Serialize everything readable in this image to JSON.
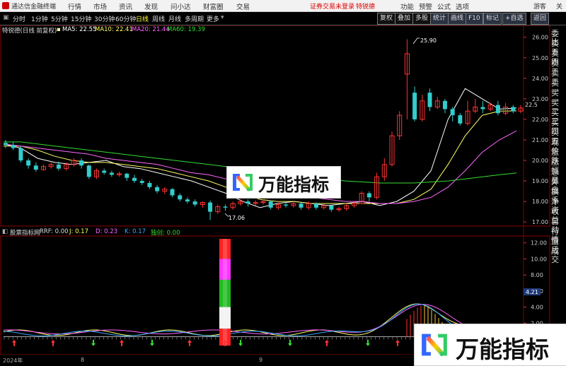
{
  "menubar": {
    "app_title": "通达信金融终端",
    "items": [
      "行情",
      "市场",
      "资讯",
      "发现",
      "问小达",
      "财富圈",
      "交易"
    ],
    "notice": "证券交易未登录",
    "tag": "特锐德",
    "guest": "游客",
    "close": "关"
  },
  "toolbar": {
    "periods": [
      "分时",
      "1分钟",
      "5分钟",
      "15分钟",
      "30分钟",
      "60分钟",
      "日线",
      "周线",
      "月线",
      "多周期",
      "更多"
    ],
    "active_period": "日线",
    "right_buttons": [
      "复权",
      "叠加",
      "多股",
      "统计",
      "画线",
      "F10",
      "标记",
      "+自选",
      "返回"
    ],
    "top_right_links": [
      "功能",
      "预警",
      "公式",
      "选项"
    ]
  },
  "info": {
    "stock": "特锐德(日线 前复权)",
    "ma5_label": "MA5: 22.55",
    "ma10_label": "MA10: 22.41",
    "ma20_label": "MA20: 21.44",
    "ma60_label": "MA60: 19.39"
  },
  "indicator": {
    "name": "股票指标网",
    "rrf": "RRF: 0.00",
    "j": "J: 0.17",
    "d": "D: 0.23",
    "k": "K: 0.17",
    "sig": "独创: 0.00"
  },
  "price_axis": {
    "ticks": [
      "26.00",
      "25.00",
      "24.00",
      "23.00",
      "22.00",
      "21.00",
      "20.00",
      "19.00",
      "18.00",
      "17.00"
    ],
    "current": "22.5"
  },
  "indicator_axis": {
    "ticks": [
      "12.00",
      "10.00",
      "8.00",
      "6.00",
      "4.00",
      "2.00"
    ],
    "current": "4.21"
  },
  "annotations": {
    "high": "25.90",
    "low": "17.06"
  },
  "side_panel": [
    "委比",
    "卖五",
    "卖四",
    "卖三",
    "卖二",
    "卖一",
    "买一",
    "买二",
    "买三",
    "买四",
    "买五",
    "现价",
    "涨跌",
    "涨幅",
    "总量",
    "外盘",
    "换手",
    "净资",
    "收益",
    "自动",
    "行情",
    "盘后",
    "成交"
  ],
  "time_axis": [
    "2024年",
    "8",
    "9"
  ],
  "watermark": "万能指标",
  "colors": {
    "up": "#ff3333",
    "down": "#33cccc",
    "ma5": "#ffffff",
    "ma10": "#ffff66",
    "ma20": "#ff66ff",
    "ma60": "#33dd33",
    "grid": "#8b0000"
  },
  "chart_data": {
    "type": "line",
    "series": [
      {
        "name": "MA5",
        "values": [
          20.8,
          20.6,
          20.1,
          19.9,
          19.8,
          19.9,
          20.0,
          19.7,
          19.6,
          19.4,
          19.2,
          19.0,
          18.7,
          18.4,
          18.0,
          17.7,
          17.9,
          18.0,
          17.9,
          17.8,
          17.9,
          18.0,
          17.8,
          18.0,
          18.5,
          19.5,
          22.0,
          23.5,
          23.0,
          22.5,
          22.55
        ]
      },
      {
        "name": "MA10",
        "values": [
          20.7,
          20.7,
          20.5,
          20.2,
          20.0,
          19.9,
          19.9,
          19.8,
          19.7,
          19.6,
          19.4,
          19.2,
          19.0,
          18.7,
          18.4,
          18.1,
          18.0,
          18.0,
          17.9,
          17.9,
          17.9,
          17.9,
          17.9,
          17.9,
          18.1,
          18.6,
          19.8,
          21.2,
          22.2,
          22.4,
          22.41
        ]
      },
      {
        "name": "MA20",
        "values": [
          20.8,
          20.7,
          20.6,
          20.5,
          20.4,
          20.3,
          20.1,
          20.0,
          19.9,
          19.8,
          19.6,
          19.4,
          19.3,
          19.1,
          18.9,
          18.7,
          18.5,
          18.3,
          18.2,
          18.1,
          18.0,
          18.0,
          17.9,
          17.9,
          18.0,
          18.2,
          18.7,
          19.5,
          20.4,
          21.0,
          21.44
        ]
      },
      {
        "name": "MA60",
        "values": [
          20.9,
          20.9,
          20.8,
          20.7,
          20.6,
          20.5,
          20.4,
          20.3,
          20.2,
          20.1,
          20.0,
          19.9,
          19.8,
          19.7,
          19.6,
          19.5,
          19.4,
          19.3,
          19.2,
          19.1,
          19.0,
          18.95,
          18.9,
          18.9,
          18.9,
          18.95,
          19.0,
          19.1,
          19.2,
          19.3,
          19.39
        ]
      }
    ],
    "ylim": [
      16.8,
      26.3
    ]
  }
}
